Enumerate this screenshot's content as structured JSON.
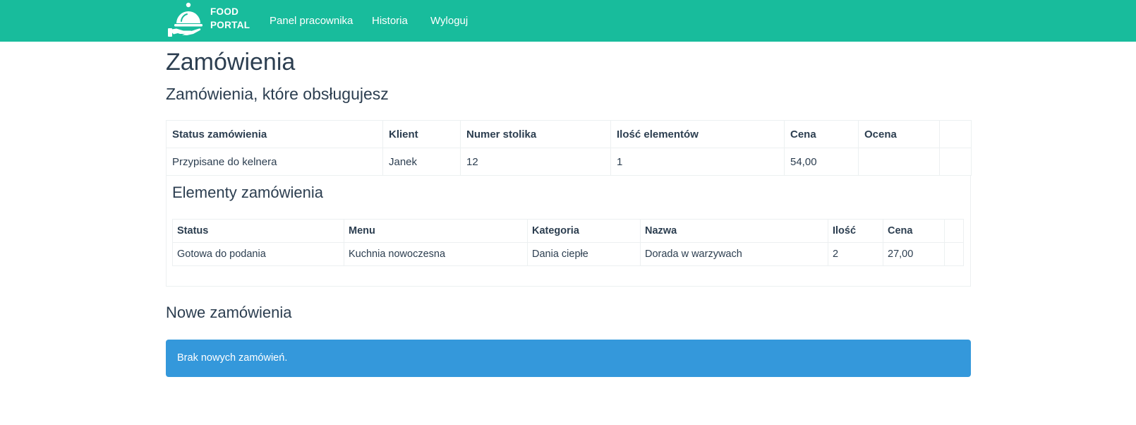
{
  "brand": {
    "line1": "FOOD",
    "line2": "PORTAL",
    "logo_icon": "serving-cloche-icon"
  },
  "nav": {
    "links": [
      {
        "label": "Panel pracownika"
      },
      {
        "label": "Historia"
      },
      {
        "label": "Wyloguj"
      }
    ]
  },
  "page": {
    "title": "Zamówienia",
    "subtitle": "Zamówienia, które obsługujesz"
  },
  "orders": {
    "headers": [
      "Status zamówienia",
      "Klient",
      "Numer stolika",
      "Ilość elementów",
      "Cena",
      "Ocena",
      ""
    ],
    "rows": [
      [
        "Przypisane do kelnera",
        "Janek",
        "12",
        "1",
        "54,00",
        "",
        ""
      ]
    ]
  },
  "order_items": {
    "title": "Elementy zamówienia",
    "headers": [
      "Status",
      "Menu",
      "Kategoria",
      "Nazwa",
      "Ilość",
      "Cena",
      ""
    ],
    "rows": [
      [
        "Gotowa do podania",
        "Kuchnia nowoczesna",
        "Dania ciepłe",
        "Dorada w warzywach",
        "2",
        "27,00",
        ""
      ]
    ]
  },
  "new_orders": {
    "title": "Nowe zamówienia",
    "empty_message": "Brak nowych zamówień."
  },
  "colors": {
    "navbar": "#18bc9c",
    "text": "#2c3e50",
    "alert": "#3498db",
    "border": "#ecf0f1"
  }
}
